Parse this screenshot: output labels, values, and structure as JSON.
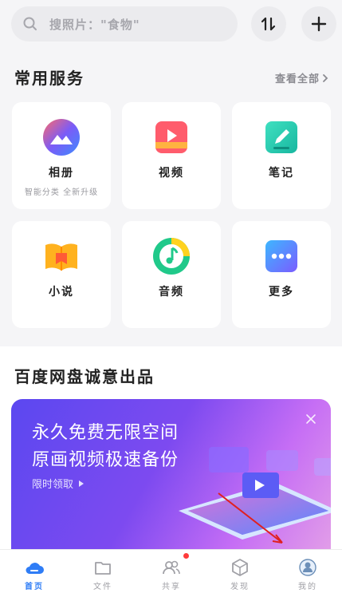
{
  "search": {
    "placeholder": "搜照片：\"食物\""
  },
  "header_actions": {
    "sort_icon": "sort-icon",
    "add_icon": "plus-icon"
  },
  "services": {
    "title": "常用服务",
    "see_all": "查看全部",
    "items": [
      {
        "label": "相册",
        "sub": "智能分类 全新升级",
        "icon": "album-icon"
      },
      {
        "label": "视频",
        "sub": "",
        "icon": "video-icon"
      },
      {
        "label": "笔记",
        "sub": "",
        "icon": "note-icon"
      },
      {
        "label": "小说",
        "sub": "",
        "icon": "novel-icon"
      },
      {
        "label": "音频",
        "sub": "",
        "icon": "audio-icon"
      },
      {
        "label": "更多",
        "sub": "",
        "icon": "more-icon"
      }
    ]
  },
  "promo": {
    "title": "百度网盘诚意出品",
    "line1": "永久免费无限空间",
    "line2": "原画视频极速备份",
    "cta": "限时领取"
  },
  "tabs": [
    {
      "label": "首页",
      "icon": "cloud-home-icon",
      "active": true
    },
    {
      "label": "文件",
      "icon": "folder-icon"
    },
    {
      "label": "共享",
      "icon": "share-users-icon"
    },
    {
      "label": "发现",
      "icon": "discover-icon"
    },
    {
      "label": "我的",
      "icon": "profile-icon"
    }
  ],
  "colors": {
    "accent": "#2f7df6",
    "badge": "#ff3b3b"
  }
}
